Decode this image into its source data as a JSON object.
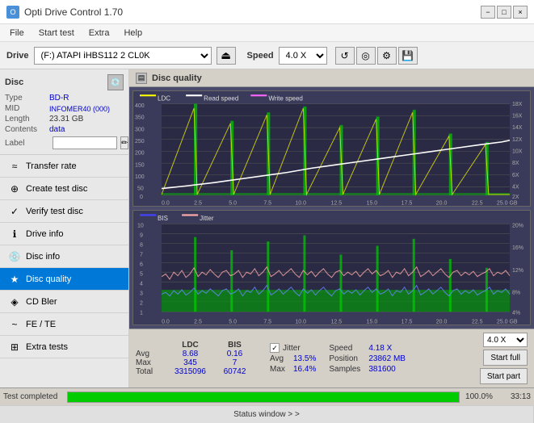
{
  "titlebar": {
    "title": "Opti Drive Control 1.70",
    "minimize": "−",
    "maximize": "□",
    "close": "×"
  },
  "menu": {
    "items": [
      "File",
      "Start test",
      "Extra",
      "Help"
    ]
  },
  "drivebar": {
    "label": "Drive",
    "drive_value": "(F:) ATAPI iHBS112  2 CL0K",
    "speed_label": "Speed",
    "speed_value": "4.0 X"
  },
  "disc": {
    "title": "Disc",
    "type_label": "Type",
    "type_value": "BD-R",
    "mid_label": "MID",
    "mid_value": "INFOMER40 (000)",
    "length_label": "Length",
    "length_value": "23.31 GB",
    "contents_label": "Contents",
    "contents_value": "data",
    "label_label": "Label"
  },
  "nav": {
    "items": [
      {
        "id": "transfer-rate",
        "label": "Transfer rate",
        "icon": "≈"
      },
      {
        "id": "create-test-disc",
        "label": "Create test disc",
        "icon": "⊕"
      },
      {
        "id": "verify-test-disc",
        "label": "Verify test disc",
        "icon": "✓"
      },
      {
        "id": "drive-info",
        "label": "Drive info",
        "icon": "ℹ"
      },
      {
        "id": "disc-info",
        "label": "Disc info",
        "icon": "💿"
      },
      {
        "id": "disc-quality",
        "label": "Disc quality",
        "icon": "★",
        "active": true
      },
      {
        "id": "cd-bler",
        "label": "CD Bler",
        "icon": "◈"
      },
      {
        "id": "fe-te",
        "label": "FE / TE",
        "icon": "~"
      },
      {
        "id": "extra-tests",
        "label": "Extra tests",
        "icon": "⊞"
      }
    ]
  },
  "disc_quality": {
    "title": "Disc quality",
    "chart1": {
      "legend": [
        {
          "color": "#ffff00",
          "label": "LDC"
        },
        {
          "color": "#ffffff",
          "label": "Read speed"
        },
        {
          "color": "#ff66ff",
          "label": "Write speed"
        }
      ],
      "y_axis_left": [
        "400",
        "350",
        "300",
        "250",
        "200",
        "150",
        "100",
        "50",
        "0"
      ],
      "y_axis_right": [
        "18X",
        "16X",
        "14X",
        "12X",
        "10X",
        "8X",
        "6X",
        "4X",
        "2X"
      ],
      "x_axis": [
        "0.0",
        "2.5",
        "5.0",
        "7.5",
        "10.0",
        "12.5",
        "15.0",
        "17.5",
        "20.0",
        "22.5",
        "25.0 GB"
      ]
    },
    "chart2": {
      "legend": [
        {
          "color": "#0000ff",
          "label": "BIS"
        },
        {
          "color": "#ffaaaa",
          "label": "Jitter"
        }
      ],
      "y_axis_left": [
        "10",
        "9",
        "8",
        "7",
        "6",
        "5",
        "4",
        "3",
        "2",
        "1"
      ],
      "y_axis_right": [
        "20%",
        "16%",
        "12%",
        "8%",
        "4%"
      ],
      "x_axis": [
        "0.0",
        "2.5",
        "5.0",
        "7.5",
        "10.0",
        "12.5",
        "15.0",
        "17.5",
        "20.0",
        "22.5",
        "25.0 GB"
      ]
    },
    "stats": {
      "col_headers": [
        "",
        "LDC",
        "BIS"
      ],
      "rows": [
        {
          "label": "Avg",
          "ldc": "8.68",
          "bis": "0.16"
        },
        {
          "label": "Max",
          "ldc": "345",
          "bis": "7"
        },
        {
          "label": "Total",
          "ldc": "3315096",
          "bis": "60742"
        }
      ],
      "jitter_checked": true,
      "jitter_label": "Jitter",
      "jitter_avg": "13.5%",
      "jitter_max": "16.4%",
      "speed_label": "Speed",
      "speed_value": "4.18 X",
      "speed_select": "4.0 X",
      "position_label": "Position",
      "position_value": "23862 MB",
      "samples_label": "Samples",
      "samples_value": "381600",
      "start_full_label": "Start full",
      "start_part_label": "Start part"
    }
  },
  "statusbar": {
    "status_text": "Test completed",
    "progress": 100,
    "progress_pct": "100.0%",
    "time": "33:13"
  },
  "bottom_nav": {
    "status_window": "Status window > >"
  }
}
